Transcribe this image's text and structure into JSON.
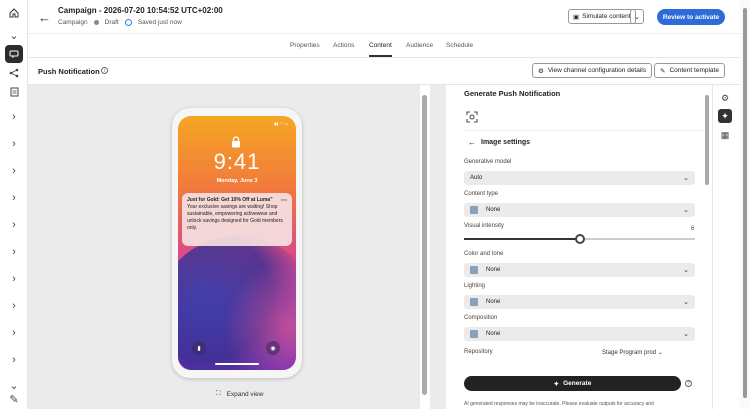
{
  "header": {
    "title": "Campaign - 2026-07-20 10:54:52 UTC+02:00",
    "breadcrumb": "Campaign",
    "status": "Draft",
    "saved": "Saved just now",
    "simulate_label": "Simulate content",
    "review_label": "Review to activate"
  },
  "tabs": [
    "Properties",
    "Actions",
    "Content",
    "Audience",
    "Schedule"
  ],
  "active_tab": "Content",
  "subheader": {
    "title": "Push Notification",
    "channel_config_label": "View channel configuration details",
    "content_template_label": "Content template"
  },
  "preview": {
    "time": "9:41",
    "date": "Monday, June 3",
    "notification_title": "Just for Gold: Get 10% Off at Luma”",
    "notification_time": "now",
    "notification_body": "Your exclusive savings are waiting! Shop sustainable, empowering activewear and unlock savings designed for Gold members only.",
    "expand_label": "Expand view"
  },
  "panel": {
    "title": "Generate Push Notification",
    "section": "Image settings",
    "generative_model_label": "Generative model",
    "generative_model_value": "Auto",
    "content_type_label": "Content type",
    "content_type_value": "None",
    "visual_intensity_label": "Visual intensity",
    "visual_intensity_value": "6",
    "visual_intensity_fraction": 0.5,
    "color_tone_label": "Color and tone",
    "color_tone_value": "None",
    "lighting_label": "Lighting",
    "lighting_value": "None",
    "composition_label": "Composition",
    "composition_value": "None",
    "repository_label": "Repository",
    "repository_value": "Stage Program prod",
    "generate_label": "Generate",
    "disclaimer": "AI generated responses may be inaccurate. Please evaluate outputs for accuracy and"
  },
  "colors": {
    "accent": "#2c6bd8",
    "dark": "#222222"
  }
}
